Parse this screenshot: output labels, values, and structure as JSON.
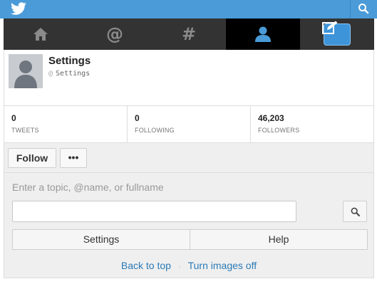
{
  "header": {
    "logo_icon": "twitter-bird-icon",
    "search_icon": "search-icon",
    "brand_color": "#4a9bd8"
  },
  "nav": {
    "items": [
      {
        "icon": "home-icon",
        "active": false
      },
      {
        "icon": "at-sign-icon",
        "active": false
      },
      {
        "icon": "hashtag-icon",
        "active": false
      },
      {
        "icon": "user-icon",
        "active": true
      },
      {
        "icon": "compose-icon",
        "active": false
      }
    ],
    "bar_color": "#333333",
    "active_color": "#000000"
  },
  "profile": {
    "name": "Settings",
    "handle_prefix": "@",
    "handle": "Settings"
  },
  "stats": [
    {
      "value": "0",
      "label": "TWEETS"
    },
    {
      "value": "0",
      "label": "FOLLOWING"
    },
    {
      "value": "46,203",
      "label": "FOLLOWERS"
    }
  ],
  "actions": {
    "follow_label": "Follow",
    "more_label": "•••"
  },
  "search": {
    "prompt": "Enter a topic, @name, or fullname",
    "value": "",
    "placeholder": ""
  },
  "buttons": {
    "settings_label": "Settings",
    "help_label": "Help"
  },
  "footer": {
    "back_to_top": "Back to top",
    "separator": "·",
    "turn_images_off": "Turn images off"
  }
}
